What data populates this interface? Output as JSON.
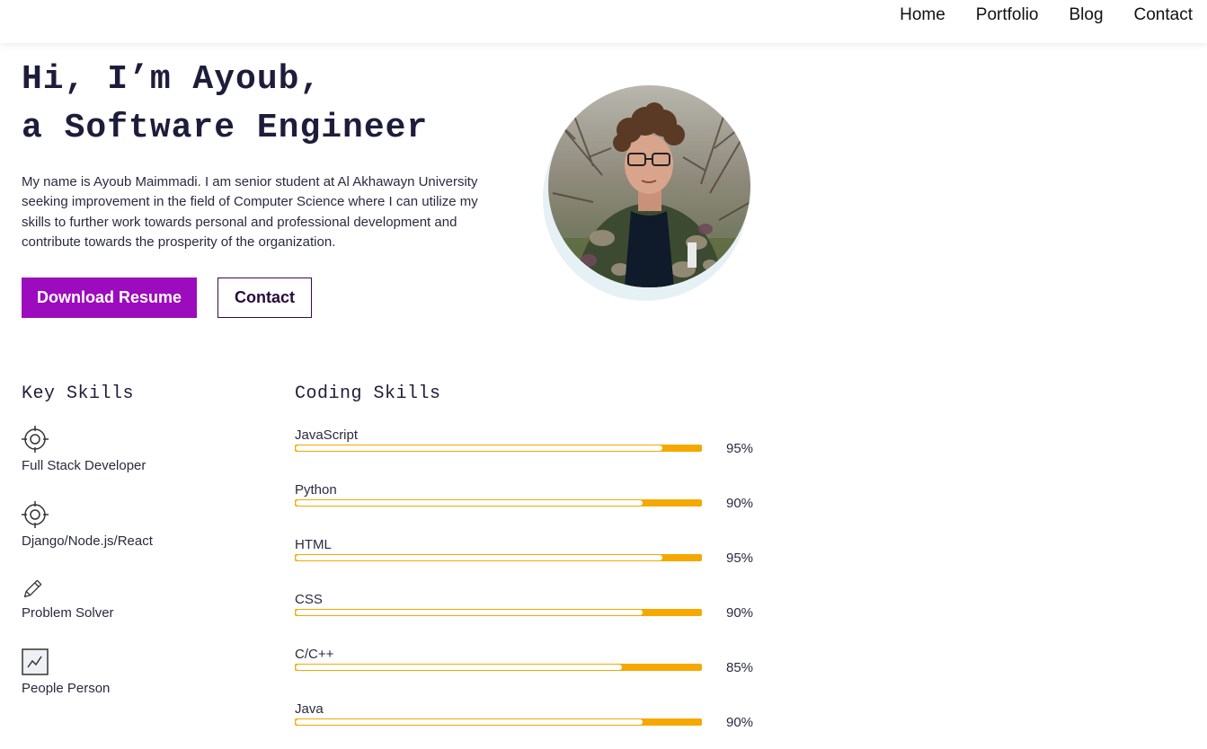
{
  "nav": {
    "links": [
      "Home",
      "Portfolio",
      "Blog",
      "Contact"
    ]
  },
  "hero": {
    "title_line1": "Hi, I’m Ayoub,",
    "title_line2": "a Software Engineer",
    "intro": "My name is Ayoub Maimmadi. I am senior student at Al Akhawayn University seeking improvement in the field of Computer Science where I can utilize my skills to further work towards personal and professional development and contribute towards the prosperity of the organization.",
    "download_label": "Download Resume",
    "contact_label": "Contact"
  },
  "key_skills": {
    "title": "Key Skills",
    "items": [
      {
        "label": "Full Stack Developer",
        "icon": "target-icon"
      },
      {
        "label": "Django/Node.js/React",
        "icon": "target-icon"
      },
      {
        "label": "Problem Solver",
        "icon": "pencil-icon"
      },
      {
        "label": "People Person",
        "icon": "chart-icon"
      }
    ]
  },
  "coding_skills": {
    "title": "Coding Skills",
    "items": [
      {
        "name": "JavaScript",
        "percent": "95%",
        "level": 0.95
      },
      {
        "name": "Python",
        "percent": "90%",
        "level": 0.9
      },
      {
        "name": "HTML",
        "percent": "95%",
        "level": 0.95
      },
      {
        "name": "CSS",
        "percent": "90%",
        "level": 0.9
      },
      {
        "name": "C/C++",
        "percent": "85%",
        "level": 0.85
      },
      {
        "name": "Java",
        "percent": "90%",
        "level": 0.9
      }
    ]
  },
  "colors": {
    "primary": "#9c0bbd",
    "bar": "#f5a800",
    "text": "#1d1d3b"
  }
}
